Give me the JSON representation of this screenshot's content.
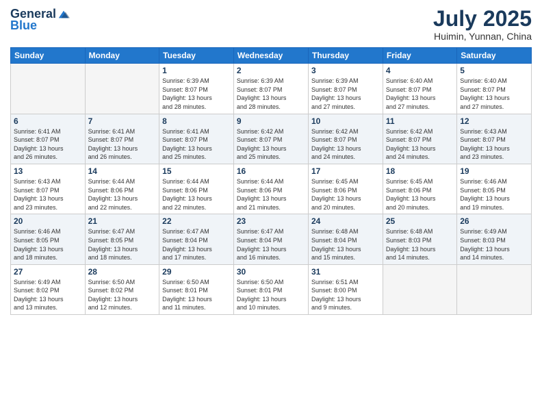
{
  "header": {
    "logo_general": "General",
    "logo_blue": "Blue",
    "month_year": "July 2025",
    "location": "Huimin, Yunnan, China"
  },
  "weekdays": [
    "Sunday",
    "Monday",
    "Tuesday",
    "Wednesday",
    "Thursday",
    "Friday",
    "Saturday"
  ],
  "weeks": [
    [
      {
        "day": "",
        "info": ""
      },
      {
        "day": "",
        "info": ""
      },
      {
        "day": "1",
        "info": "Sunrise: 6:39 AM\nSunset: 8:07 PM\nDaylight: 13 hours\nand 28 minutes."
      },
      {
        "day": "2",
        "info": "Sunrise: 6:39 AM\nSunset: 8:07 PM\nDaylight: 13 hours\nand 28 minutes."
      },
      {
        "day": "3",
        "info": "Sunrise: 6:39 AM\nSunset: 8:07 PM\nDaylight: 13 hours\nand 27 minutes."
      },
      {
        "day": "4",
        "info": "Sunrise: 6:40 AM\nSunset: 8:07 PM\nDaylight: 13 hours\nand 27 minutes."
      },
      {
        "day": "5",
        "info": "Sunrise: 6:40 AM\nSunset: 8:07 PM\nDaylight: 13 hours\nand 27 minutes."
      }
    ],
    [
      {
        "day": "6",
        "info": "Sunrise: 6:41 AM\nSunset: 8:07 PM\nDaylight: 13 hours\nand 26 minutes."
      },
      {
        "day": "7",
        "info": "Sunrise: 6:41 AM\nSunset: 8:07 PM\nDaylight: 13 hours\nand 26 minutes."
      },
      {
        "day": "8",
        "info": "Sunrise: 6:41 AM\nSunset: 8:07 PM\nDaylight: 13 hours\nand 25 minutes."
      },
      {
        "day": "9",
        "info": "Sunrise: 6:42 AM\nSunset: 8:07 PM\nDaylight: 13 hours\nand 25 minutes."
      },
      {
        "day": "10",
        "info": "Sunrise: 6:42 AM\nSunset: 8:07 PM\nDaylight: 13 hours\nand 24 minutes."
      },
      {
        "day": "11",
        "info": "Sunrise: 6:42 AM\nSunset: 8:07 PM\nDaylight: 13 hours\nand 24 minutes."
      },
      {
        "day": "12",
        "info": "Sunrise: 6:43 AM\nSunset: 8:07 PM\nDaylight: 13 hours\nand 23 minutes."
      }
    ],
    [
      {
        "day": "13",
        "info": "Sunrise: 6:43 AM\nSunset: 8:07 PM\nDaylight: 13 hours\nand 23 minutes."
      },
      {
        "day": "14",
        "info": "Sunrise: 6:44 AM\nSunset: 8:06 PM\nDaylight: 13 hours\nand 22 minutes."
      },
      {
        "day": "15",
        "info": "Sunrise: 6:44 AM\nSunset: 8:06 PM\nDaylight: 13 hours\nand 22 minutes."
      },
      {
        "day": "16",
        "info": "Sunrise: 6:44 AM\nSunset: 8:06 PM\nDaylight: 13 hours\nand 21 minutes."
      },
      {
        "day": "17",
        "info": "Sunrise: 6:45 AM\nSunset: 8:06 PM\nDaylight: 13 hours\nand 20 minutes."
      },
      {
        "day": "18",
        "info": "Sunrise: 6:45 AM\nSunset: 8:06 PM\nDaylight: 13 hours\nand 20 minutes."
      },
      {
        "day": "19",
        "info": "Sunrise: 6:46 AM\nSunset: 8:05 PM\nDaylight: 13 hours\nand 19 minutes."
      }
    ],
    [
      {
        "day": "20",
        "info": "Sunrise: 6:46 AM\nSunset: 8:05 PM\nDaylight: 13 hours\nand 18 minutes."
      },
      {
        "day": "21",
        "info": "Sunrise: 6:47 AM\nSunset: 8:05 PM\nDaylight: 13 hours\nand 18 minutes."
      },
      {
        "day": "22",
        "info": "Sunrise: 6:47 AM\nSunset: 8:04 PM\nDaylight: 13 hours\nand 17 minutes."
      },
      {
        "day": "23",
        "info": "Sunrise: 6:47 AM\nSunset: 8:04 PM\nDaylight: 13 hours\nand 16 minutes."
      },
      {
        "day": "24",
        "info": "Sunrise: 6:48 AM\nSunset: 8:04 PM\nDaylight: 13 hours\nand 15 minutes."
      },
      {
        "day": "25",
        "info": "Sunrise: 6:48 AM\nSunset: 8:03 PM\nDaylight: 13 hours\nand 14 minutes."
      },
      {
        "day": "26",
        "info": "Sunrise: 6:49 AM\nSunset: 8:03 PM\nDaylight: 13 hours\nand 14 minutes."
      }
    ],
    [
      {
        "day": "27",
        "info": "Sunrise: 6:49 AM\nSunset: 8:02 PM\nDaylight: 13 hours\nand 13 minutes."
      },
      {
        "day": "28",
        "info": "Sunrise: 6:50 AM\nSunset: 8:02 PM\nDaylight: 13 hours\nand 12 minutes."
      },
      {
        "day": "29",
        "info": "Sunrise: 6:50 AM\nSunset: 8:01 PM\nDaylight: 13 hours\nand 11 minutes."
      },
      {
        "day": "30",
        "info": "Sunrise: 6:50 AM\nSunset: 8:01 PM\nDaylight: 13 hours\nand 10 minutes."
      },
      {
        "day": "31",
        "info": "Sunrise: 6:51 AM\nSunset: 8:00 PM\nDaylight: 13 hours\nand 9 minutes."
      },
      {
        "day": "",
        "info": ""
      },
      {
        "day": "",
        "info": ""
      }
    ]
  ]
}
